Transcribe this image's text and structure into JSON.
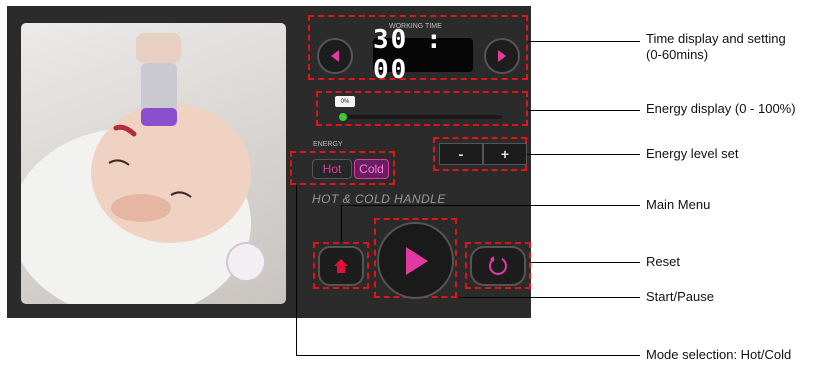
{
  "timer": {
    "label": "WORKING TIME",
    "value": "30 : 00",
    "prev_icon": "left-triangle-icon",
    "next_icon": "right-triangle-icon"
  },
  "energy": {
    "percent_label": "0%",
    "level": 0,
    "section_label": "ENERGY",
    "minus_label": "-",
    "plus_label": "+"
  },
  "mode": {
    "hot_label": "Hot",
    "cold_label": "Cold",
    "selected": "Cold"
  },
  "handle_title": "HOT & COLD  HANDLE",
  "controls": {
    "home_icon": "home-icon",
    "play_icon": "play-icon",
    "reset_icon": "reset-icon"
  },
  "annotations": {
    "time": "Time display and setting\n(0-60mins)",
    "energy_display": "Energy display (0 - 100%)",
    "energy_level": "Energy level set",
    "main_menu": "Main Menu",
    "reset": "Reset",
    "start_pause": "Start/Pause",
    "mode": "Mode selection: Hot/Cold"
  },
  "colors": {
    "panel": "#2b2b2b",
    "callout": "#e01616",
    "accent_pink": "#e23aa0",
    "home_red": "#e0103a",
    "level_green": "#3acb3a"
  }
}
